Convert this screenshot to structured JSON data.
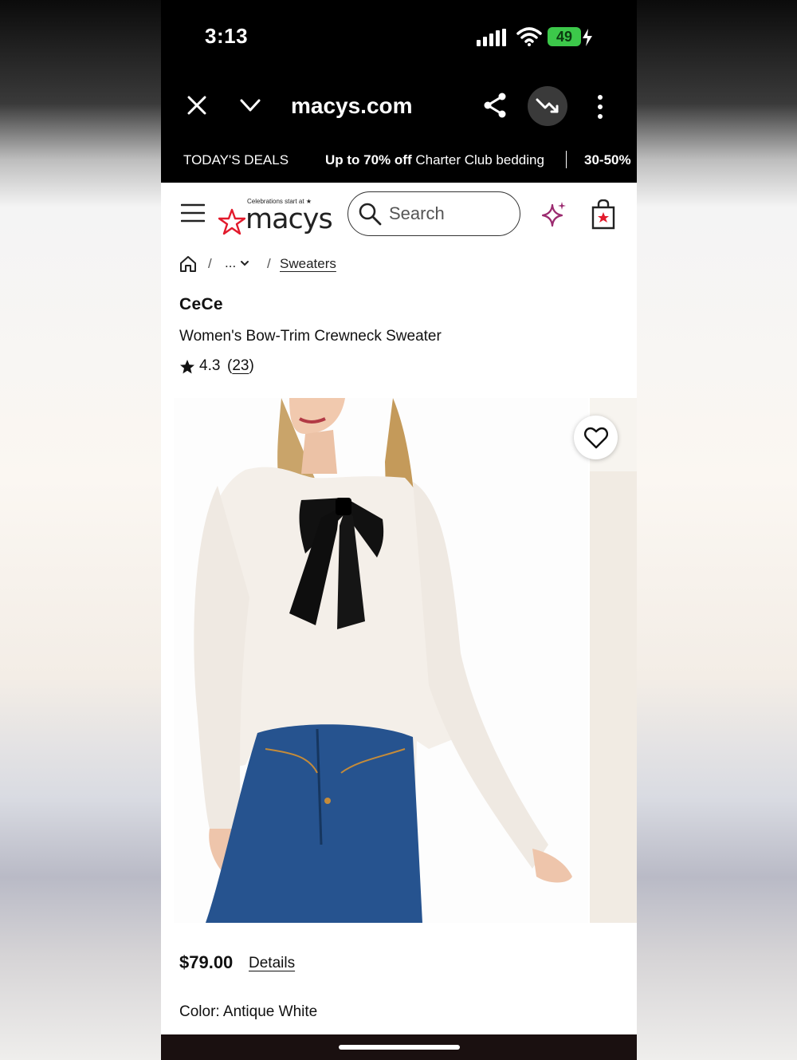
{
  "status_bar": {
    "time": "3:13",
    "battery": "49"
  },
  "browser": {
    "url": "macys.com"
  },
  "deals_bar": {
    "label": "TODAY'S DEALS",
    "promo_bold": "Up to 70% off",
    "promo_rest": " Charter Club bedding",
    "next_promo": "30-50%"
  },
  "header": {
    "logo_tagline": "Celebrations start at ★",
    "logo_word": "macys",
    "search_placeholder": "Search"
  },
  "breadcrumb": {
    "sep": "/",
    "more": "...",
    "current": "Sweaters"
  },
  "product": {
    "brand": "CeCe",
    "name": "Women's Bow-Trim Crewneck Sweater",
    "rating": "4.3",
    "review_count": "23",
    "price": "$79.00",
    "details_link": "Details",
    "color_label": "Color: Antique White"
  },
  "colors": {
    "brand_red": "#e21a2c",
    "sparkle": "#9b2a6f",
    "battery_green": "#3cc84a"
  }
}
